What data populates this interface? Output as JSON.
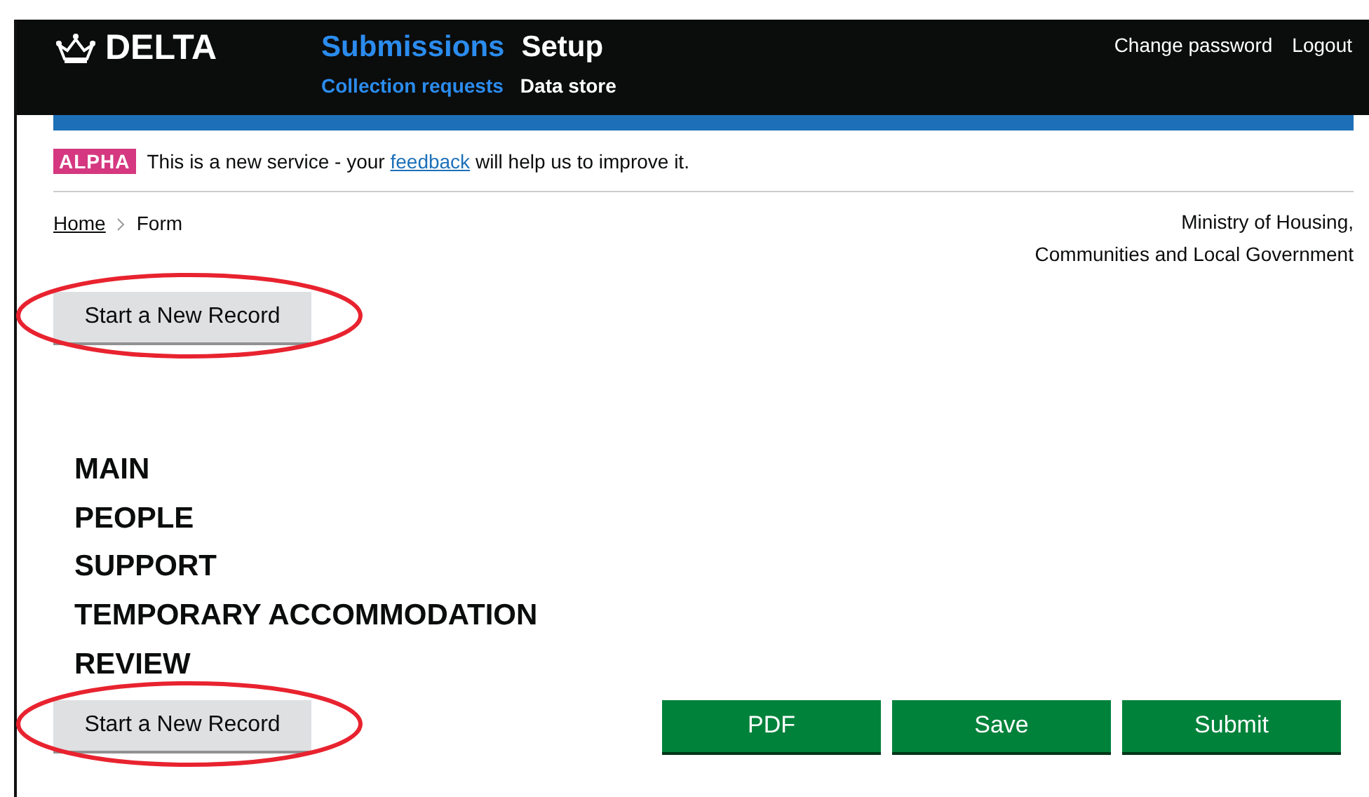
{
  "header": {
    "logo": "DELTA",
    "nav": [
      {
        "label": "Submissions",
        "selected": true
      },
      {
        "label": "Setup",
        "selected": false
      }
    ],
    "subnav": [
      {
        "label": "Collection requests",
        "selected": true
      },
      {
        "label": "Data store",
        "selected": false
      }
    ],
    "links": [
      "Change password",
      "Logout"
    ]
  },
  "banner": {
    "tag": "ALPHA",
    "text_before": "This is a new service - your",
    "link": "feedback",
    "text_after": "will help us to improve it."
  },
  "breadcrumbs": [
    "Home",
    "Form"
  ],
  "organisation": [
    "Ministry of Housing,",
    "Communities and Local Government"
  ],
  "top_button": {
    "label": "Start a New Record",
    "annotated": true
  },
  "sections": [
    "MAIN",
    "PEOPLE",
    "SUPPORT",
    "TEMPORARY ACCOMMODATION",
    "REVIEW"
  ],
  "bottom_button": {
    "label": "Start a New Record",
    "annotated": true
  },
  "actions": [
    "PDF",
    "Save",
    "Submit"
  ]
}
